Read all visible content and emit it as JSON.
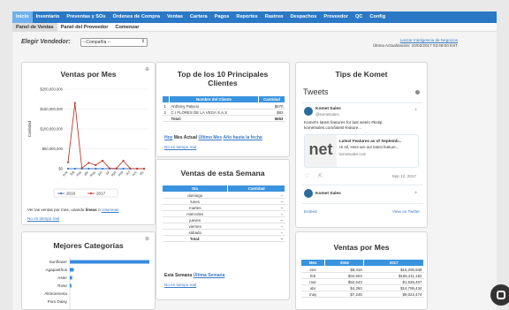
{
  "nav": {
    "tabs": [
      "Inicio",
      "Inventario",
      "Preventas y SOs",
      "Órdenes de Compra",
      "Ventas",
      "Cartera",
      "Pagos",
      "Reportes",
      "Rastreo",
      "Despachos",
      "Proveedor",
      "QC",
      "Config"
    ],
    "subtabs": [
      "Panel de Ventas",
      "Panel del Proveedor",
      "Comenzar"
    ]
  },
  "vendor": {
    "label": "Elegir Vendedor:",
    "selected": "--Compañía --"
  },
  "header": {
    "intel_link": "Lanzar Inteligencia de Negocios",
    "update": "Última Actualización: 10/02/2017 03:48:00 EST"
  },
  "sales_month": {
    "title": "Ventas por Mes",
    "ylabel": "Cantidad",
    "note": "Ver las ventas por mes, usando",
    "note_lines": "líneas",
    "note_o": "o",
    "note_columns": "columnas",
    "realtime": "No en tiempo real"
  },
  "chart_data": {
    "type": "line",
    "categories": [
      "ene",
      "feb",
      "mar",
      "abr",
      "may",
      "jun",
      "jul",
      "ago",
      "sep",
      "oct",
      "nov",
      "dic"
    ],
    "yticks": [
      "$200,000,000",
      "$150,000,000",
      "$100,000,000",
      "$50,000,000",
      "$0"
    ],
    "ylim": [
      0,
      200000000
    ],
    "series": [
      {
        "name": "2016",
        "color": "#3a74c9",
        "values": [
          8416,
          34504,
          52643,
          4260,
          7245,
          3000,
          2500,
          2000,
          2000,
          1500,
          1000,
          1000
        ]
      },
      {
        "name": "2017",
        "color": "#c0392b",
        "values": [
          16290948,
          165211192,
          1536407,
          14795434,
          9022474,
          20000000,
          1000000,
          500000,
          20000000,
          500000,
          0,
          0
        ]
      }
    ]
  },
  "top10": {
    "title": "Top de los 10 Principales Clientes",
    "headers": [
      "Nombre del Cliente",
      "Cantidad"
    ],
    "rows": [
      {
        "n": "1",
        "name": "Anthony Palacio",
        "amt": "$570"
      },
      {
        "n": "2",
        "name": "C.I FLORES DE LA VEGA S.A.S",
        "amt": "$83"
      }
    ],
    "total_label": "Total:",
    "total": "$653",
    "filters": [
      "Hoy",
      "Mes Actual",
      "Último Mes",
      "Año hasta la fecha"
    ],
    "realtime": "No en tiempo real"
  },
  "week": {
    "title": "Ventas de esta Semana",
    "headers": [
      "Día",
      "Cantidad"
    ],
    "rows": [
      {
        "day": "domingo",
        "amt": "--"
      },
      {
        "day": "lunes",
        "amt": "--"
      },
      {
        "day": "martes",
        "amt": "--"
      },
      {
        "day": "miércoles",
        "amt": "--"
      },
      {
        "day": "jueves",
        "amt": "--"
      },
      {
        "day": "viernes",
        "amt": "--"
      },
      {
        "day": "sábado",
        "amt": "--"
      }
    ],
    "total_label": "Total:",
    "total": "--",
    "filters": [
      "Esta Semana",
      "Última Semana"
    ],
    "realtime": "No en tiempo real"
  },
  "tips": {
    "title": "Tips de Komet",
    "tweets_label": "Tweets",
    "tw1_name": "Komet Sales",
    "tw1_handle": "@kometsales",
    "tw1_text": "Komet's latest features for last week! #kotip kometsales.com/latest-feature...",
    "card_title": "Latest Features as of Septemb...",
    "card_desc": "Hi All, Here are our latest feature...",
    "card_domain": "kometsales.com",
    "card_img_text": "net",
    "tw1_date": "Sep 12, 2017",
    "tw2_name": "Komet Sales",
    "embed": "Embed",
    "view": "View on Twitter"
  },
  "categories": {
    "title": "Mejores Categorías",
    "items": [
      "Sunflower",
      "Agapanthus",
      "Aster",
      "Rose",
      "Alstroemeria",
      "Pom Daisy"
    ],
    "values": [
      100,
      5,
      3,
      2,
      0,
      0
    ]
  },
  "sales_month_table": {
    "title": "Ventas por Mes",
    "headers": [
      "Mes",
      "2016",
      "2017"
    ],
    "rows": [
      {
        "m": "ene",
        "a": "$8,416",
        "b": "$16,290,948"
      },
      {
        "m": "feb",
        "a": "$34,504",
        "b": "$165,211,192"
      },
      {
        "m": "mar",
        "a": "$52,643",
        "b": "$1,536,407"
      },
      {
        "m": "abr",
        "a": "$4,260",
        "b": "$14,795,434"
      },
      {
        "m": "may",
        "a": "$7,245",
        "b": "$9,022,474"
      }
    ]
  }
}
